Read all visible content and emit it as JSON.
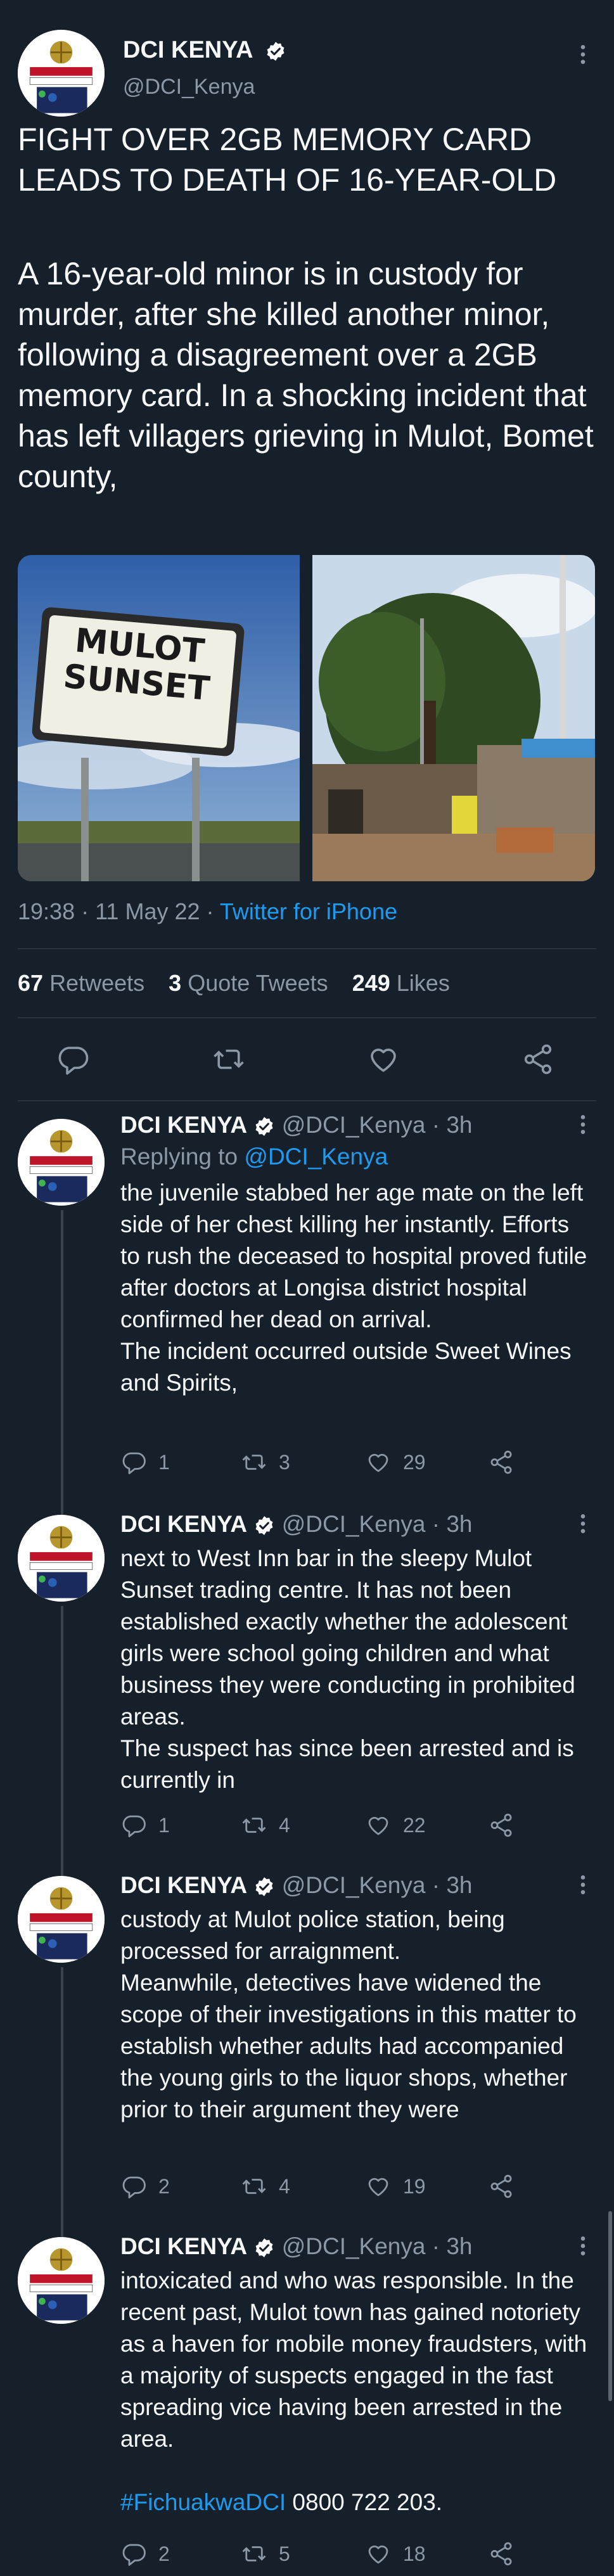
{
  "main": {
    "author_name": "DCI KENYA",
    "author_handle": "@DCI_Kenya",
    "avatar_text": "#FICHUAKWADCI",
    "avatar_phone": "0800-722-203",
    "headline": "FIGHT OVER 2GB MEMORY CARD LEADS TO DEATH OF 16-YEAR-OLD",
    "body": "A 16-year-old minor is in custody for murder, after she killed another minor, following a disagreement over a 2GB memory card. In a shocking incident that has left villagers grieving in Mulot, Bomet county,",
    "sign_text": "MULOT\nSUNSET",
    "time": "19:38 · 11 May 22 · ",
    "source": "Twitter for iPhone",
    "retweets": "67",
    "retweets_label": "Retweets",
    "quotes": "3",
    "quotes_label": "Quote Tweets",
    "likes": "249",
    "likes_label": "Likes"
  },
  "replies": [
    {
      "name": "DCI KENYA",
      "handle_time": "@DCI_Kenya · 3h",
      "replying_prefix": "Replying to ",
      "replying_to": "@DCI_Kenya",
      "body": "the juvenile stabbed her age mate on the left side of her chest killing her instantly. Efforts to rush the deceased to hospital proved futile after doctors at Longisa district hospital confirmed her dead on arrival.\nThe incident occurred outside Sweet Wines and Spirits,",
      "replies": "1",
      "retweets": "3",
      "likes": "29"
    },
    {
      "name": "DCI KENYA",
      "handle_time": "@DCI_Kenya · 3h",
      "body": "next to West Inn bar in the sleepy Mulot Sunset trading centre. It has not been established exactly whether the adolescent girls were school going children and what business they were conducting in prohibited areas.\nThe suspect has since been arrested and is currently in",
      "replies": "1",
      "retweets": "4",
      "likes": "22"
    },
    {
      "name": "DCI KENYA",
      "handle_time": "@DCI_Kenya · 3h",
      "body": "custody at Mulot police station, being processed for arraignment.\nMeanwhile, detectives have widened the scope of their investigations in this matter to establish whether adults had accompanied the young girls to the liquor shops, whether prior to their argument they were",
      "replies": "2",
      "retweets": "4",
      "likes": "19"
    },
    {
      "name": "DCI KENYA",
      "handle_time": "@DCI_Kenya · 3h",
      "body": "intoxicated and who was responsible. In the recent past, Mulot town has gained notoriety as a haven for mobile money fraudsters, with a majority of suspects engaged in the fast spreading vice having been arrested in the area.",
      "hashtag": "#FichuakwaDCI",
      "phone": " 0800 722 203.",
      "replies": "2",
      "retweets": "5",
      "likes": "18"
    }
  ],
  "colors": {
    "background": "#15202b",
    "text": "#f7f9f9",
    "muted": "#8b98a5",
    "link": "#1d9bf0",
    "divider": "#38444d",
    "verified": "#ffffff"
  }
}
